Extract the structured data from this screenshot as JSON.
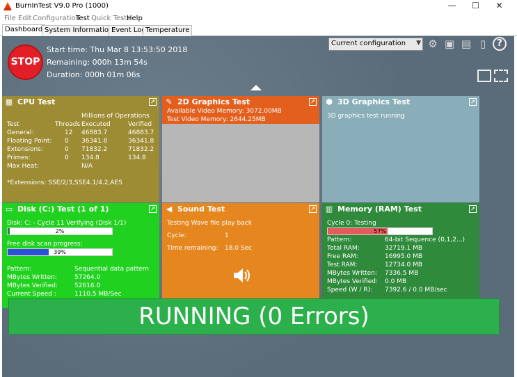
{
  "window": {
    "title": "BurnInTest V9.0 Pro (1000)",
    "minimize": "—",
    "maximize": "☐",
    "close": "✕"
  },
  "menu": [
    "File",
    "Edit",
    "Configuration",
    "Test",
    "Quick Tests",
    "Help"
  ],
  "tabs": [
    "Dashboard",
    "System Information",
    "Event Log",
    "Temperature"
  ],
  "header": {
    "stop_label": "STOP",
    "start_time": "Start time: Thu Mar  8 13:53:50 2018",
    "remaining": "Remaining: 000h 13m 54s",
    "duration": "Duration: 000h 01m 06s",
    "config": "Current configuration"
  },
  "cpu": {
    "title": "CPU Test",
    "millions": "Millions of Operations",
    "col_test": "Test",
    "col_threads": "Threads",
    "col_executed": "Executed",
    "col_verified": "Verified",
    "rows": [
      {
        "name": "General:",
        "threads": "12",
        "executed": "46883.7",
        "verified": "46883.7"
      },
      {
        "name": "Floating Point:",
        "threads": "0",
        "executed": "36341.8",
        "verified": "36341.8"
      },
      {
        "name": "Extensions:",
        "threads": "0",
        "executed": "71832.2",
        "verified": "71832.2"
      },
      {
        "name": "Primes:",
        "threads": "0",
        "executed": "134.8",
        "verified": "134.8"
      }
    ],
    "max_heat_label": "Max Heat:",
    "max_heat_value": "N/A",
    "extensions_note": "*Extensions: SSE/2/3,SSE4.1/4.2,AES",
    "color": "#9d8c33"
  },
  "gfx2d": {
    "title": "2D Graphics Test",
    "available": "Available Video Memory: 3072.00MB",
    "test_mem": "Test Video Memory: 2644.25MB",
    "color": "#e25f1e"
  },
  "gfx3d": {
    "title": "3D Graphics Test",
    "status": "3D graphics test running",
    "color": "#8aaeb9"
  },
  "disk": {
    "title": "Disk (C:) Test (1 of 1)",
    "cycle": "Disk: C: - Cycle 11 Verifying (Disk 1/1)",
    "cycle_pct": "2%",
    "cycle_progress": 0.02,
    "free_label": "Free disk scan progress:",
    "free_pct": "39%",
    "free_progress": 0.39,
    "pattern_label": "Pattern:",
    "pattern_value": "Sequential data pattern",
    "written_label": "MBytes Written:",
    "written_value": "57264.0",
    "verified_label": "MBytes Verified:",
    "verified_value": "52616.0",
    "speed_label": "Current Speed :",
    "speed_value": "1110.5 MB/Sec",
    "color": "#21d11f"
  },
  "sound": {
    "title": "Sound Test",
    "status": "Testing Wave file play back",
    "cycle_label": "Cycle:",
    "cycle_value": "1",
    "time_label": "Time remaining:",
    "time_value": "18.0 Sec",
    "color": "#e5861e"
  },
  "memory": {
    "title": "Memory (RAM) Test",
    "cycle": "Cycle 0: Testing",
    "pct": "57%",
    "progress": 0.57,
    "rows": [
      {
        "label": "Pattern:",
        "value": "64-bit Sequence (0,1,2...)"
      },
      {
        "label": "Total RAM:",
        "value": "32719.1 MB"
      },
      {
        "label": "Free RAM:",
        "value": "16995.0 MB"
      },
      {
        "label": "Test RAM:",
        "value": "12734.0 MB"
      },
      {
        "label": "MBytes Written:",
        "value": "7336.5 MB"
      },
      {
        "label": "MBytes Verified:",
        "value": "0.0 MB"
      },
      {
        "label": "Speed (W / R):",
        "value": "7392.6 / 0.0  MB/sec"
      }
    ],
    "color": "#2f8a3c"
  },
  "status": {
    "text": "RUNNING (0 Errors)"
  }
}
